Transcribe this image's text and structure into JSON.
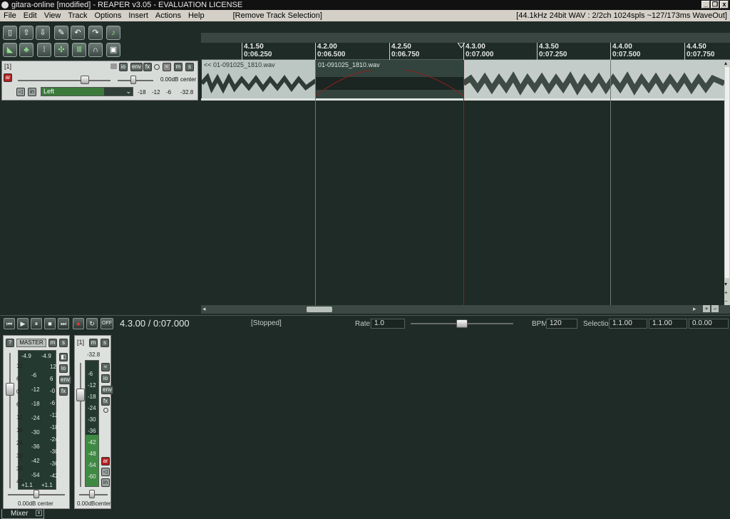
{
  "window": {
    "title": "gitara-online [modified] - REAPER v3.05 - EVALUATION LICENSE",
    "controls": [
      "_",
      "❐",
      "x"
    ]
  },
  "menu": {
    "items": [
      "File",
      "Edit",
      "View",
      "Track",
      "Options",
      "Insert",
      "Actions",
      "Help"
    ],
    "extra": "[Remove Track Selection]",
    "status": "[44.1kHz 24bit WAV : 2/2ch 1024spls ~127/173ms WaveOut]"
  },
  "toolbar": {
    "icons_row1": [
      "new-project-icon",
      "open-project-icon",
      "save-project-icon",
      "wrench-icon",
      "undo-icon",
      "redo-icon",
      "metronome-icon"
    ],
    "icons_row2": [
      "envelope-icon",
      "ripple-icon",
      "grid-icon",
      "snap-icon",
      "item-lock-icon",
      "loop-icon",
      "lock-icon"
    ]
  },
  "ruler": {
    "marks": [
      {
        "bar": "4.1.50",
        "time": "0:06.250"
      },
      {
        "bar": "4.2.00",
        "time": "0:06.500"
      },
      {
        "bar": "4.2.50",
        "time": "0:06.750"
      },
      {
        "bar": "4.3.00",
        "time": "0:07.000"
      },
      {
        "bar": "4.3.50",
        "time": "0:07.250"
      },
      {
        "bar": "4.4.00",
        "time": "0:07.500"
      },
      {
        "bar": "4.4.50",
        "time": "0:07.750"
      }
    ]
  },
  "track": {
    "number": "[1]",
    "buttons": {
      "io": "io",
      "env": "env",
      "fx": "fx",
      "mute": "m",
      "solo": "s",
      "arm": "ar"
    },
    "volume": "0.00dB",
    "pan": "center",
    "input": "Left",
    "meter_ticks": [
      "-18",
      "-12",
      "-6",
      "-32.8"
    ]
  },
  "items": [
    {
      "label": "<< 01-091025_1810.wav"
    },
    {
      "label": "01-091025_1810.wav"
    }
  ],
  "transport": {
    "position": "4.3.00 / 0:07.000",
    "state": "[Stopped]",
    "rate_label": "Rate:",
    "rate": "1.0",
    "bpm_label": "BPM:",
    "bpm": "120",
    "selection_label": "Selection:",
    "sel_start": "1.1.00",
    "sel_end": "1.1.00",
    "sel_len": "0.0.00",
    "off_label": "OFF"
  },
  "mixer": {
    "master": {
      "name": "MASTER",
      "peak_l": "-4.9",
      "peak_r": "-4.9",
      "scale_left": [
        "12",
        "6",
        "0",
        "6",
        "12",
        "18",
        "24",
        "30",
        "36",
        "42"
      ],
      "scale_mid": [
        "-6",
        "-12",
        "-18",
        "-24",
        "-30",
        "-36",
        "-42",
        "-54"
      ],
      "scale_right": [
        "12",
        "6",
        "-0",
        "-6",
        "-12",
        "-18",
        "-24",
        "-30",
        "-36",
        "-42"
      ],
      "hold_l": "+1.1",
      "hold_r": "+1.1",
      "vol_label": "0.00dB center"
    },
    "track1": {
      "name": "[1]",
      "peak": "-32.8",
      "scale": [
        "-6",
        "-12",
        "-18",
        "-24",
        "-30",
        "-36",
        "-42",
        "-48",
        "-54",
        "-60"
      ],
      "vol_label": "0.00dBcenter"
    },
    "tab_label": "Mixer"
  }
}
